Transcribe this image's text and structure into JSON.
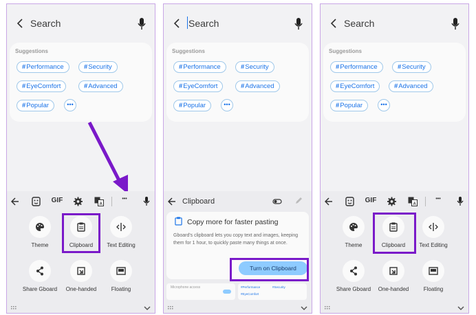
{
  "panels": [
    {
      "search": {
        "placeholder": "Search"
      },
      "suggestions": {
        "title": "Suggestions",
        "chips": [
          "Performance",
          "Security",
          "EyeComfort",
          "Advanced",
          "Popular"
        ],
        "more": "•••"
      },
      "toolbar": {
        "gif": "GIF",
        "more": "•••"
      },
      "tiles": [
        "Theme",
        "Clipboard",
        "Text Editing",
        "Share Gboard",
        "One-handed",
        "Floating"
      ]
    },
    {
      "search": {
        "placeholder": "Search"
      },
      "suggestions": {
        "title": "Suggestions",
        "chips": [
          "Performance",
          "Security",
          "EyeComfort",
          "Advanced",
          "Popular"
        ],
        "more": "•••"
      },
      "clipboard": {
        "title": "Clipboard",
        "card_title": "Copy more for faster pasting",
        "card_body": "Gboard's clipboard lets you copy text and images, keeping them for 1 hour, to quickly paste many things at once.",
        "button": "Turn on Clipboard",
        "mini_label": "Microphone access",
        "mini_chips": [
          "#Performance",
          "#Security",
          "#EyeComfort"
        ]
      }
    },
    {
      "search": {
        "placeholder": "Search"
      },
      "suggestions": {
        "title": "Suggestions",
        "chips": [
          "Performance",
          "Security",
          "EyeComfort",
          "Advanced",
          "Popular"
        ],
        "more": "•••"
      },
      "toolbar": {
        "gif": "GIF",
        "more": "•••"
      },
      "tiles": [
        "Theme",
        "Clipboard",
        "Text Editing",
        "Share Gboard",
        "One-handed",
        "Floating"
      ]
    }
  ],
  "colors": {
    "highlight": "#7a19c9",
    "chip_text": "#1a73e8",
    "button_bg": "#8ecbff"
  },
  "icons": [
    "back-arrow-icon",
    "mic-icon",
    "sticker-icon",
    "gear-icon",
    "translate-icon",
    "palette-icon",
    "clipboard-icon",
    "text-cursor-icon",
    "share-icon",
    "one-handed-icon",
    "floating-icon",
    "keyboard-grid-icon",
    "chevron-down-icon",
    "toggle-icon",
    "pencil-icon"
  ]
}
